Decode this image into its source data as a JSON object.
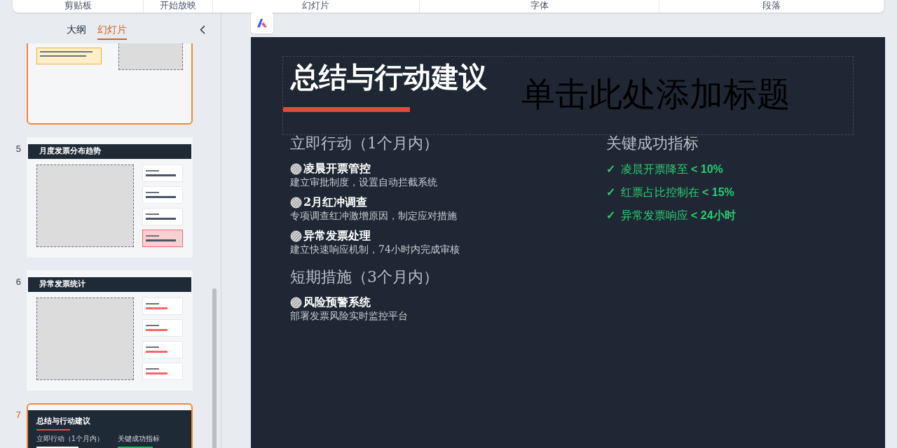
{
  "ribbon": {
    "groups": [
      "剪贴板",
      "开始放映",
      "幻灯片",
      "字体",
      "段落"
    ]
  },
  "sidebar": {
    "tabs": [
      {
        "label": "大纲",
        "selected": false
      },
      {
        "label": "幻灯片",
        "selected": true
      }
    ],
    "slides": [
      {
        "kind": "notes",
        "selected": true
      },
      {
        "number": "5",
        "kind": "cards",
        "title": "月度发票分布趋势",
        "selected": false
      },
      {
        "number": "6",
        "kind": "stats",
        "title": "异常发票统计",
        "selected": false
      },
      {
        "number": "7",
        "kind": "summary",
        "title": "总结与行动建议",
        "left_heading": "立即行动（1个月内）",
        "right_heading": "关键成功指标",
        "selected": true
      }
    ]
  },
  "slide": {
    "title": "总结与行动建议",
    "title_placeholder": "单击此处添加标题",
    "sections": [
      {
        "heading": "立即行动（1个月内）",
        "items": [
          {
            "title": "凌晨开票管控",
            "text": "建立审批制度，设置自动拦截系统"
          },
          {
            "title": "2月红冲调查",
            "text": "专项调查红冲激增原因，制定应对措施"
          },
          {
            "title": "异常发票处理",
            "text": "建立快速响应机制，74小时内完成审核"
          }
        ]
      },
      {
        "heading": "短期措施（3个月内）",
        "items": [
          {
            "title": "风险预警系统",
            "text": "部署发票风险实时监控平台"
          }
        ]
      }
    ],
    "metrics_heading": "关键成功指标",
    "metrics": [
      {
        "mark": "✓",
        "label": "凌晨开票降至",
        "value": "< 10%"
      },
      {
        "mark": "✓",
        "label": "红票占比控制在",
        "value": "< 15%"
      },
      {
        "mark": "✓",
        "label": "异常发票响应",
        "value": "< 24小时"
      }
    ]
  }
}
